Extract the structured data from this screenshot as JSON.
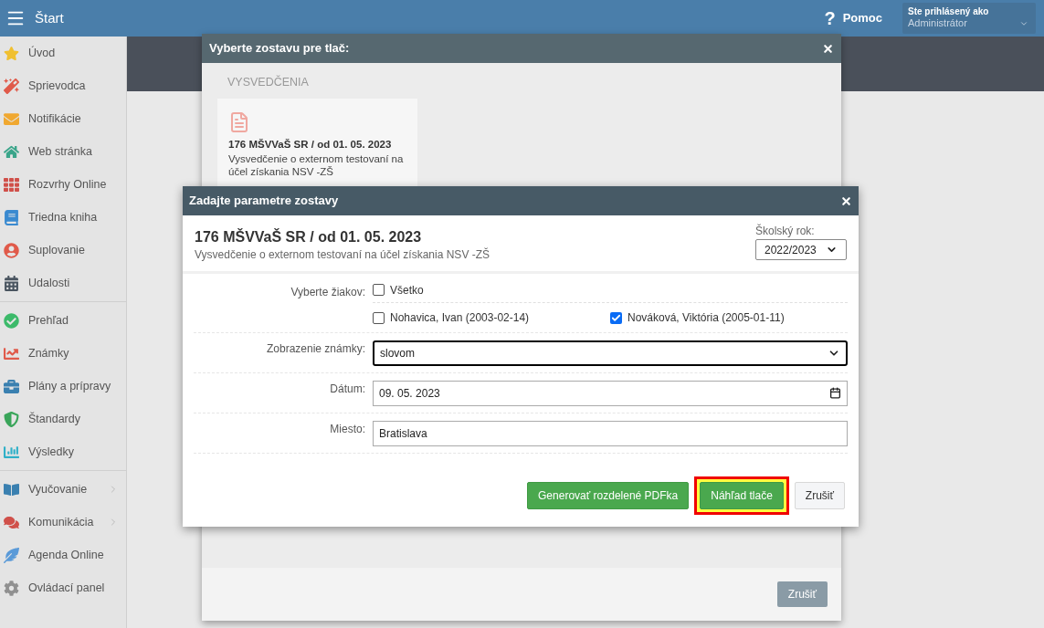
{
  "topbar": {
    "title": "Štart",
    "help_icon": "?",
    "help": "Pomoc",
    "user_label": "Ste prihlásený ako",
    "user_name": "Administrátor"
  },
  "sidebar": {
    "groups": [
      [
        {
          "label": "Úvod",
          "color": "#f0c030",
          "submenu": false
        },
        {
          "label": "Sprievodca",
          "color": "#e05a4a",
          "submenu": false
        },
        {
          "label": "Notifikácie",
          "color": "#f0a830",
          "submenu": false
        },
        {
          "label": "Web stránka",
          "color": "#3aa58a",
          "submenu": false
        },
        {
          "label": "Rozvrhy Online",
          "color": "#d0504a",
          "submenu": false
        },
        {
          "label": "Triedna kniha",
          "color": "#3a8ad0",
          "submenu": false
        },
        {
          "label": "Suplovanie",
          "color": "#e05a4a",
          "submenu": false
        },
        {
          "label": "Udalosti",
          "color": "#4a5560",
          "submenu": false
        }
      ],
      [
        {
          "label": "Prehľad",
          "color": "#3cba6a",
          "submenu": false
        },
        {
          "label": "Známky",
          "color": "#e05a4a",
          "submenu": false
        },
        {
          "label": "Plány a prípravy",
          "color": "#3a80b0",
          "submenu": false
        },
        {
          "label": "Štandardy",
          "color": "#3aa55a",
          "submenu": false
        },
        {
          "label": "Výsledky",
          "color": "#30b0c8",
          "submenu": false
        }
      ],
      [
        {
          "label": "Vyučovanie",
          "color": "#3a80b0",
          "submenu": true
        },
        {
          "label": "Komunikácia",
          "color": "#d0504a",
          "submenu": true
        },
        {
          "label": "Agenda Online",
          "color": "#5a9ad8",
          "submenu": false
        },
        {
          "label": "Ovládací panel",
          "color": "#909090",
          "submenu": false
        }
      ]
    ]
  },
  "report_dialog": {
    "title": "Vyberte zostavu pre tlač:",
    "section": "VYSVEDČENIA",
    "card": {
      "title": "176 MŠVVaŠ SR / od 01. 05. 2023",
      "description": "Vysvedčenie o externom testovaní na účel získania NSV -ZŠ"
    },
    "cancel": "Zrušiť"
  },
  "params_dialog": {
    "title": "Zadajte parametre zostavy",
    "heading": "176 MŠVVaŠ SR / od 01. 05. 2023",
    "subheading": "Vysvedčenie o externom testovaní na účel získania NSV -ZŠ",
    "year_label": "Školský rok:",
    "year_value": "2022/2023",
    "students_label": "Vyberte žiakov:",
    "select_all": {
      "label": "Všetko",
      "checked": false
    },
    "students": [
      {
        "label": "Nohavica, Ivan (2003-02-14)",
        "checked": false
      },
      {
        "label": "Nováková, Viktória (2005-01-11)",
        "checked": true
      }
    ],
    "grade_label": "Zobrazenie známky:",
    "grade_value": "slovom",
    "date_label": "Dátum:",
    "date_value": "09. 05. 2023",
    "place_label": "Miesto:",
    "place_value": "Bratislava",
    "buttons": [
      {
        "label": "Generovať rozdelené PDFka",
        "kind": "success",
        "highlighted": false
      },
      {
        "label": "Náhľad tlače",
        "kind": "success",
        "highlighted": true
      },
      {
        "label": "Zrušiť",
        "kind": "default",
        "highlighted": false
      }
    ]
  }
}
